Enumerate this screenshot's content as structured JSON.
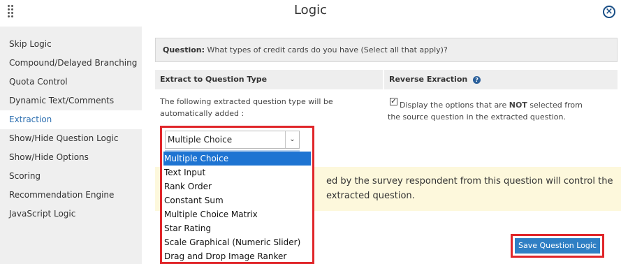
{
  "dialog": {
    "title": "Logic",
    "close_glyph": "×",
    "drag_icon": "drag-handle-icon"
  },
  "sidebar": {
    "items": [
      {
        "label": "Skip Logic",
        "active": false
      },
      {
        "label": "Compound/Delayed Branching",
        "active": false
      },
      {
        "label": "Quota Control",
        "active": false
      },
      {
        "label": "Dynamic Text/Comments",
        "active": false
      },
      {
        "label": "Extraction",
        "active": true
      },
      {
        "label": "Show/Hide Question Logic",
        "active": false
      },
      {
        "label": "Show/Hide Options",
        "active": false
      },
      {
        "label": "Scoring",
        "active": false
      },
      {
        "label": "Recommendation Engine",
        "active": false
      },
      {
        "label": "JavaScript Logic",
        "active": false
      }
    ]
  },
  "question": {
    "label": "Question:",
    "text": "What types of credit cards do you have (Select all that apply)?"
  },
  "extract": {
    "header": "Extract to Question Type",
    "desc_line1": "The following extracted question type will be",
    "desc_line2": "automatically added :"
  },
  "reverse": {
    "header": "Reverse Exraction",
    "help_glyph": "?",
    "checked": true,
    "desc_before": "Display the options that are ",
    "desc_bold": "NOT",
    "desc_after": " selected from the source question in the extracted question."
  },
  "warning": {
    "line1": "ed by the survey respondent from this question will control the",
    "line2": "extracted question."
  },
  "dropdown": {
    "selected_value": "Multiple Choice",
    "chevron": "⌄",
    "options": [
      {
        "label": "Multiple Choice",
        "selected": true
      },
      {
        "label": "Text Input",
        "selected": false
      },
      {
        "label": "Rank Order",
        "selected": false
      },
      {
        "label": "Constant Sum",
        "selected": false
      },
      {
        "label": "Multiple Choice Matrix",
        "selected": false
      },
      {
        "label": "Star Rating",
        "selected": false
      },
      {
        "label": "Scale Graphical (Numeric Slider)",
        "selected": false
      },
      {
        "label": "Drag and Drop Image Ranker",
        "selected": false
      }
    ]
  },
  "actions": {
    "save_label": "Save Question Logic"
  },
  "colors": {
    "accent": "#2f7fc4",
    "highlight": "#e0262a",
    "selected_option": "#1e74d2",
    "active_sidebar_text": "#2d6fb0"
  }
}
